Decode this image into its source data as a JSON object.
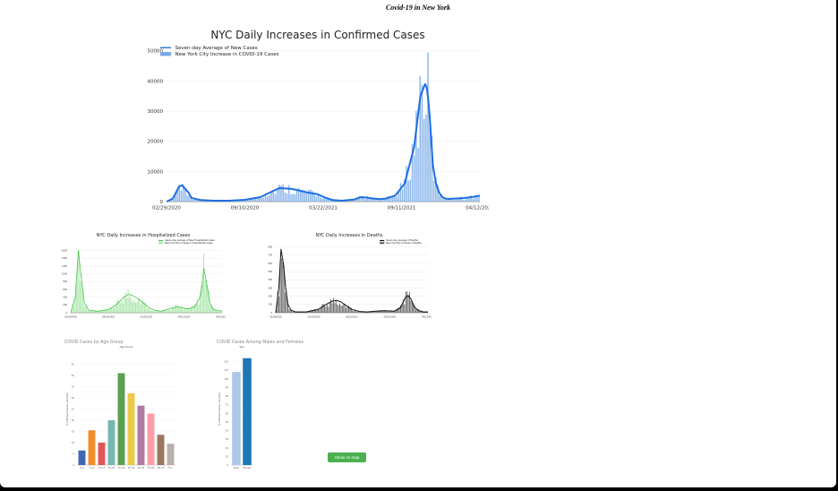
{
  "page_title": "Covid-19 in New York",
  "map_button_label": "Show on map",
  "chart_data": [
    {
      "id": "cases",
      "type": "bar",
      "title": "NYC Daily Increases in Confirmed Cases",
      "xlabel": "",
      "ylabel": "",
      "x_ticks": [
        "02/29/2020",
        "09/10/2020",
        "03/22/2021",
        "09/11/2021",
        "04/12/2022"
      ],
      "ylim": [
        0,
        55000
      ],
      "y_ticks": [
        0,
        10000,
        20000,
        30000,
        40000,
        50000
      ],
      "grid": true,
      "legend_position": "top-left",
      "series": [
        {
          "name": "Seven-day Average of New Cases",
          "kind": "line",
          "color": "#1f6fe0",
          "x": [
            0.0,
            0.02,
            0.04,
            0.05,
            0.07,
            0.08,
            0.11,
            0.15,
            0.2,
            0.25,
            0.3,
            0.33,
            0.36,
            0.4,
            0.43,
            0.45,
            0.48,
            0.51,
            0.53,
            0.56,
            0.6,
            0.62,
            0.64,
            0.66,
            0.68,
            0.7,
            0.73,
            0.76,
            0.79,
            0.81,
            0.825,
            0.83,
            0.835,
            0.84,
            0.845,
            0.85,
            0.86,
            0.87,
            0.88,
            0.89,
            0.9,
            0.92,
            0.95,
            0.98,
            1.0
          ],
          "values": [
            0,
            1000,
            5000,
            5400,
            3000,
            1200,
            500,
            300,
            300,
            600,
            1500,
            3000,
            4500,
            4200,
            3500,
            3000,
            2500,
            1200,
            500,
            300,
            700,
            1500,
            1300,
            1000,
            800,
            1000,
            2000,
            6000,
            18000,
            35000,
            39000,
            38000,
            34000,
            28000,
            20000,
            12000,
            6000,
            3000,
            1500,
            1000,
            900,
            1000,
            1200,
            1600,
            2000
          ]
        },
        {
          "name": "New York City Increase in COVID-19 Cases",
          "kind": "bar",
          "color": "#78a9e8"
        }
      ]
    },
    {
      "id": "hosp",
      "type": "bar",
      "title": "NYC Daily Increases in Hospitalized Cases",
      "x_ticks": [
        "02/29/2020",
        "09/10/2020",
        "03/22/2021",
        "09/11/2021",
        "04/12/2022"
      ],
      "ylim": [
        0,
        1800
      ],
      "y_ticks": [
        0,
        200,
        400,
        600,
        800,
        1000,
        1200,
        1400,
        1600
      ],
      "grid": true,
      "legend_position": "top-right",
      "series": [
        {
          "name": "Seven-day Average of New Hospitalized Cases",
          "kind": "line",
          "color": "#4fc44f",
          "x": [
            0.0,
            0.03,
            0.05,
            0.07,
            0.09,
            0.12,
            0.18,
            0.25,
            0.3,
            0.35,
            0.38,
            0.4,
            0.42,
            0.45,
            0.48,
            0.52,
            0.56,
            0.6,
            0.66,
            0.7,
            0.73,
            0.75,
            0.78,
            0.82,
            0.86,
            0.88,
            0.9,
            0.92,
            0.94,
            0.97,
            1.0
          ],
          "values": [
            0,
            400,
            1600,
            900,
            250,
            60,
            40,
            80,
            200,
            400,
            470,
            460,
            420,
            350,
            250,
            120,
            60,
            40,
            110,
            150,
            140,
            110,
            100,
            150,
            450,
            1150,
            700,
            250,
            90,
            60,
            40
          ]
        },
        {
          "name": "New York City Increase in Hospitalized Cases",
          "kind": "bar",
          "color": "#9fe39f"
        }
      ]
    },
    {
      "id": "deaths",
      "type": "bar",
      "title": "NYC Daily Increases in Deaths",
      "x_ticks": [
        "02/29/2020",
        "09/10/2020",
        "03/22/2021",
        "09/11/2021",
        "04/12/2022"
      ],
      "ylim": [
        0,
        850
      ],
      "y_ticks": [
        0,
        100,
        200,
        300,
        400,
        500,
        600,
        700,
        800
      ],
      "grid": true,
      "legend_position": "top-right",
      "series": [
        {
          "name": "Seven-day Average of Deaths",
          "kind": "line",
          "color": "#111111",
          "x": [
            0.0,
            0.02,
            0.035,
            0.05,
            0.065,
            0.08,
            0.1,
            0.13,
            0.2,
            0.28,
            0.33,
            0.37,
            0.4,
            0.43,
            0.46,
            0.5,
            0.55,
            0.6,
            0.66,
            0.72,
            0.78,
            0.82,
            0.85,
            0.87,
            0.89,
            0.91,
            0.94,
            0.97,
            1.0
          ],
          "values": [
            0,
            300,
            770,
            600,
            300,
            100,
            30,
            10,
            10,
            40,
            100,
            140,
            150,
            130,
            90,
            40,
            15,
            10,
            20,
            25,
            20,
            60,
            180,
            210,
            160,
            70,
            25,
            10,
            10
          ]
        },
        {
          "name": "New York City Increase in Deaths",
          "kind": "bar",
          "color": "#555555"
        }
      ]
    },
    {
      "id": "age",
      "type": "bar",
      "title": "COVID Cases by Age Group",
      "bar_label": "Age Group",
      "xlabel": "",
      "ylabel": "Confirmed Cases (x1,000)",
      "ylim": [
        0,
        50
      ],
      "y_ticks": [
        0,
        5,
        10,
        15,
        20,
        25,
        30,
        35,
        40,
        45
      ],
      "categories": [
        "0-4",
        "5-12",
        "13-17",
        "18-24",
        "25-34",
        "35-44",
        "45-54",
        "55-64",
        "65-74",
        "75+"
      ],
      "values": [
        6.5,
        15.5,
        10,
        20,
        41,
        32,
        26.5,
        23,
        13.5,
        9.5
      ],
      "colors": [
        "#3f67b0",
        "#f28e2b",
        "#e15759",
        "#76b7b2",
        "#59a14f",
        "#edc948",
        "#b07aa1",
        "#ff9da7",
        "#9c755f",
        "#bab0ac"
      ]
    },
    {
      "id": "sex",
      "type": "bar",
      "title": "COVID Cases Among Males and Females",
      "bar_label": "Sex",
      "xlabel": "",
      "ylabel": "Confirmed Cases (x1,000)",
      "ylim": [
        0,
        130
      ],
      "y_ticks": [
        0,
        10,
        20,
        30,
        40,
        50,
        60,
        70,
        80,
        90,
        100,
        110,
        120
      ],
      "categories": [
        "Male",
        "Female"
      ],
      "values": [
        108,
        124
      ],
      "colors": [
        "#aec7e8",
        "#1f77b4"
      ]
    }
  ]
}
